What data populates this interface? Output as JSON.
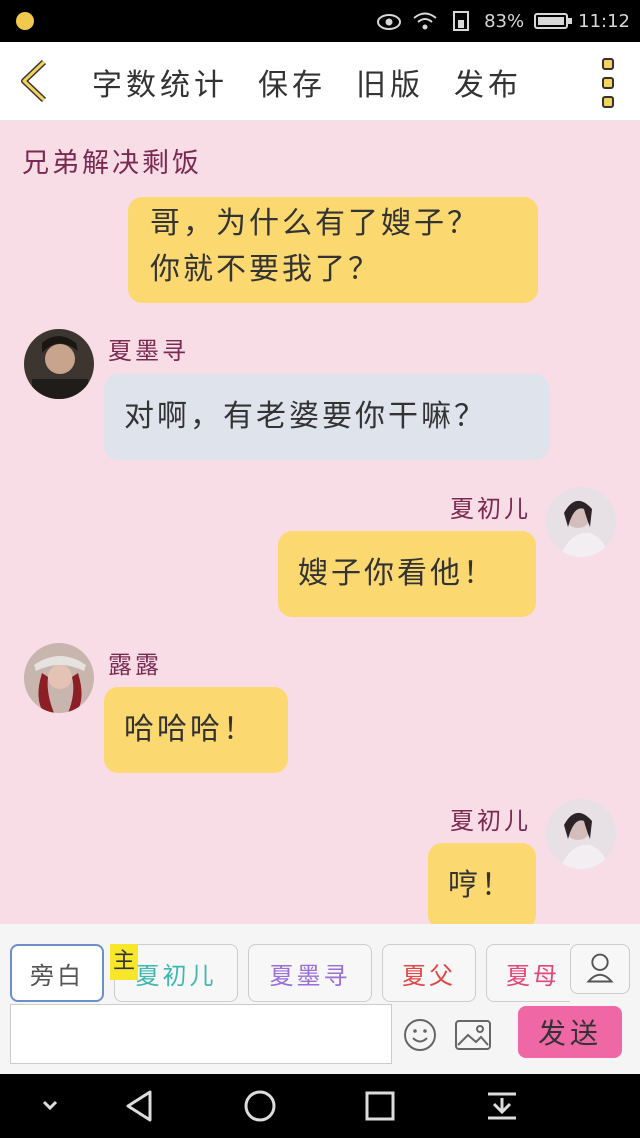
{
  "status_bar": {
    "battery": "83%",
    "time": "11:12"
  },
  "toolbar": {
    "items": [
      "字数统计",
      "保存",
      "旧版",
      "发布"
    ]
  },
  "story": {
    "title": "兄弟解决剩饭"
  },
  "messages": [
    {
      "side": "right",
      "color": "yellow",
      "text": "哥，为什么有了嫂子？你就不要我了？",
      "text_l1": "哥，为什么有了嫂子？",
      "text_l2": "你就不要我了？"
    },
    {
      "side": "left",
      "color": "blue",
      "name": "夏墨寻",
      "text": "对啊，有老婆要你干嘛？"
    },
    {
      "side": "right",
      "color": "yellow",
      "name": "夏初儿",
      "text": "嫂子你看他！"
    },
    {
      "side": "left",
      "color": "yellow",
      "name": "露露",
      "text": "哈哈哈！"
    },
    {
      "side": "right",
      "color": "yellow",
      "name": "夏初儿",
      "text": "哼！"
    }
  ],
  "roles": {
    "items": [
      {
        "label": "旁白",
        "color": "#555555"
      },
      {
        "label": "夏初儿",
        "color": "#3fb8b0"
      },
      {
        "label": "夏墨寻",
        "color": "#9a6fd6"
      },
      {
        "label": "夏父",
        "color": "#e04848"
      },
      {
        "label": "夏母",
        "color": "#e0487a"
      }
    ],
    "main_badge": "主"
  },
  "composer": {
    "input_value": "",
    "send_label": "发送"
  },
  "colors": {
    "background": "#f9dde6",
    "bubble_yellow": "#fbd870",
    "bubble_blue": "#dfe4ec",
    "send": "#f067a6",
    "name": "#7a2a52"
  }
}
